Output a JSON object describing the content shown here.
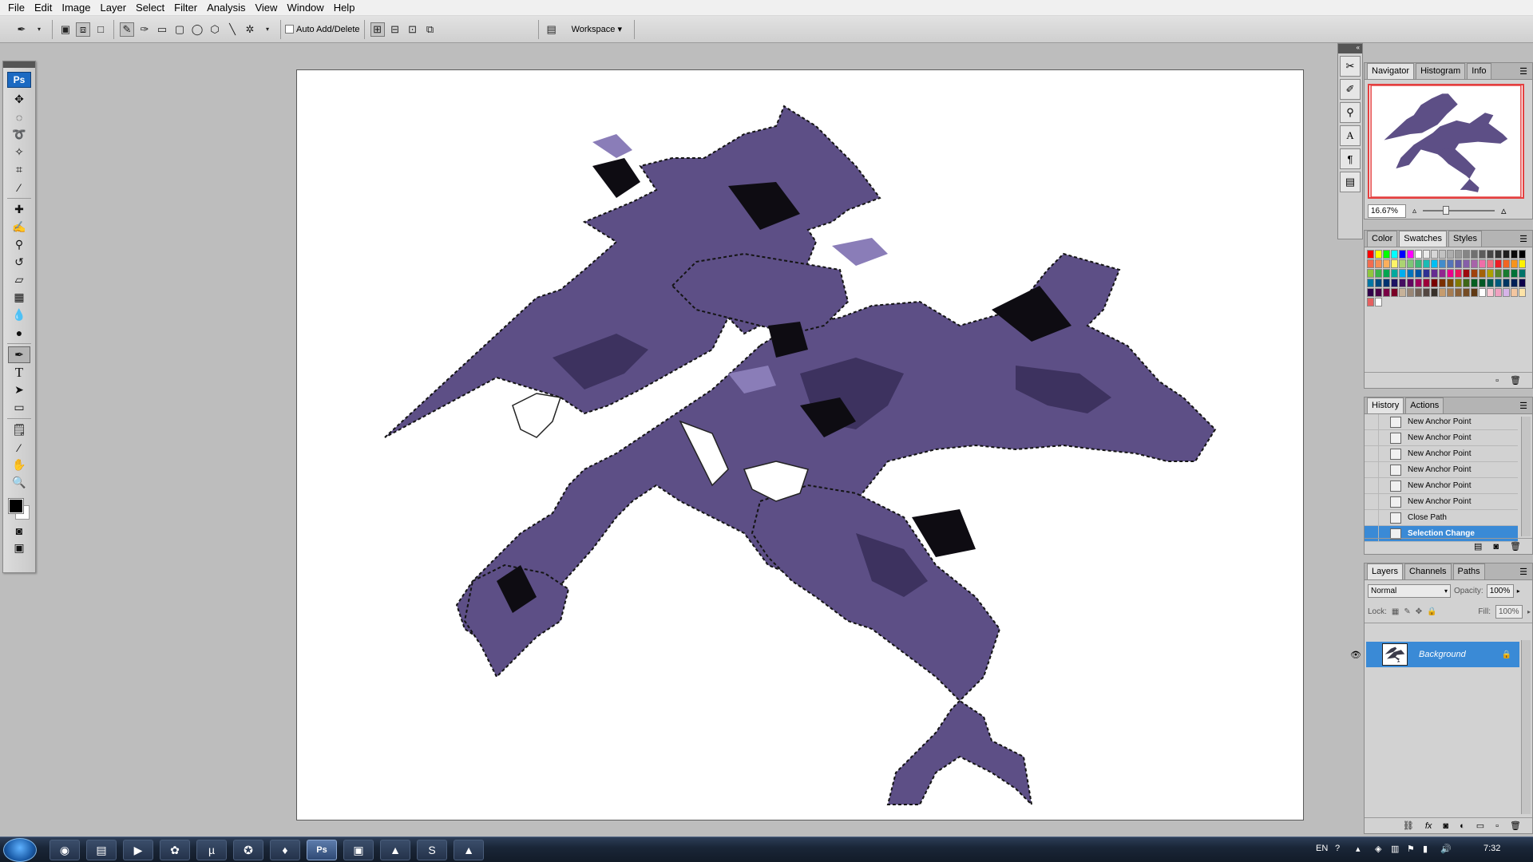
{
  "menu": [
    "File",
    "Edit",
    "Image",
    "Layer",
    "Select",
    "Filter",
    "Analysis",
    "View",
    "Window",
    "Help"
  ],
  "options": {
    "auto_add_delete": "Auto Add/Delete",
    "workspace": "Workspace ▾"
  },
  "toolbox": {
    "logo": "Ps",
    "tools": [
      "move-tool",
      "lasso-tool",
      "polygonal-lasso-tool",
      "magic-wand-tool",
      "crop-tool",
      "eyedropper-tool",
      "healing-brush-tool",
      "brush-tool",
      "clone-stamp-tool",
      "history-brush-tool",
      "eraser-tool",
      "gradient-tool",
      "blur-tool",
      "dodge-tool",
      "pen-tool",
      "type-tool",
      "path-selection-tool",
      "rectangle-tool",
      "notes-tool",
      "eyedropper-tool-2",
      "hand-tool",
      "zoom-tool"
    ],
    "foreground_color": "#000000",
    "background_color": "#ffffff"
  },
  "navigator": {
    "tabs": [
      "Navigator",
      "Histogram",
      "Info"
    ],
    "zoom": "16.67%"
  },
  "swatches": {
    "tabs": [
      "Color",
      "Swatches",
      "Styles"
    ],
    "colors": [
      "#ff0000",
      "#ffff00",
      "#00ff00",
      "#00ffff",
      "#0000ff",
      "#ff00ff",
      "#ffffff",
      "#ebebeb",
      "#d6d6d6",
      "#c2c2c2",
      "#adadad",
      "#999999",
      "#858585",
      "#707070",
      "#5c5c5c",
      "#474747",
      "#333333",
      "#1f1f1f",
      "#0a0a0a",
      "#000000",
      "#f26c4f",
      "#f68e55",
      "#fbaf5c",
      "#fff467",
      "#acd372",
      "#7cc576",
      "#3bb878",
      "#1abbb4",
      "#00bff3",
      "#438ccb",
      "#5574b9",
      "#605ca9",
      "#855fa8",
      "#a763a9",
      "#ef6ea8",
      "#f16d7e",
      "#ee1d24",
      "#f16522",
      "#f7941d",
      "#fff100",
      "#8fc63d",
      "#37b44a",
      "#00a650",
      "#00a99e",
      "#00aeef",
      "#0072bc",
      "#0054a5",
      "#2f3192",
      "#652c91",
      "#91278f",
      "#ec008c",
      "#ed145a",
      "#9d0a0e",
      "#a0410d",
      "#a36209",
      "#aba000",
      "#588528",
      "#197b30",
      "#007236",
      "#00736a",
      "#0076a4",
      "#004a80",
      "#003370",
      "#1d1363",
      "#450e61",
      "#62055f",
      "#9e005c",
      "#9d0039",
      "#790000",
      "#7b3000",
      "#7c4900",
      "#827a00",
      "#3e6617",
      "#045f20",
      "#005824",
      "#005951",
      "#005b7e",
      "#003562",
      "#002056",
      "#0c004b",
      "#30004a",
      "#4b0048",
      "#7a0045",
      "#7a0026",
      "#c7b299",
      "#998675",
      "#736357",
      "#534741",
      "#37302a",
      "#c69c6e",
      "#a67c52",
      "#8c6239",
      "#754c24",
      "#603913",
      "#ffffff",
      "#fbc8d4",
      "#f0a0c0",
      "#d7b4e8",
      "#f4c6a0",
      "#fde3a7",
      "#e56060",
      "#ffffff"
    ]
  },
  "history": {
    "tabs": [
      "History",
      "Actions"
    ],
    "items": [
      "New Anchor Point",
      "New Anchor Point",
      "New Anchor Point",
      "New Anchor Point",
      "New Anchor Point",
      "New Anchor Point",
      "Close Path",
      "Selection Change"
    ]
  },
  "layers": {
    "tabs": [
      "Layers",
      "Channels",
      "Paths"
    ],
    "blend_mode": "Normal",
    "opacity_label": "Opacity:",
    "opacity": "100%",
    "lock_label": "Lock:",
    "fill_label": "Fill:",
    "fill": "100%",
    "layer_name": "Background"
  },
  "taskbar": {
    "apps": [
      "chrome",
      "explorer",
      "media-player",
      "paint-app",
      "utorrent",
      "game-app",
      "evernote",
      "photoshop",
      "remote-desktop",
      "photo-app",
      "skype",
      "vlc"
    ],
    "active_app": "photoshop",
    "lang": "EN",
    "clock": "7:32"
  }
}
